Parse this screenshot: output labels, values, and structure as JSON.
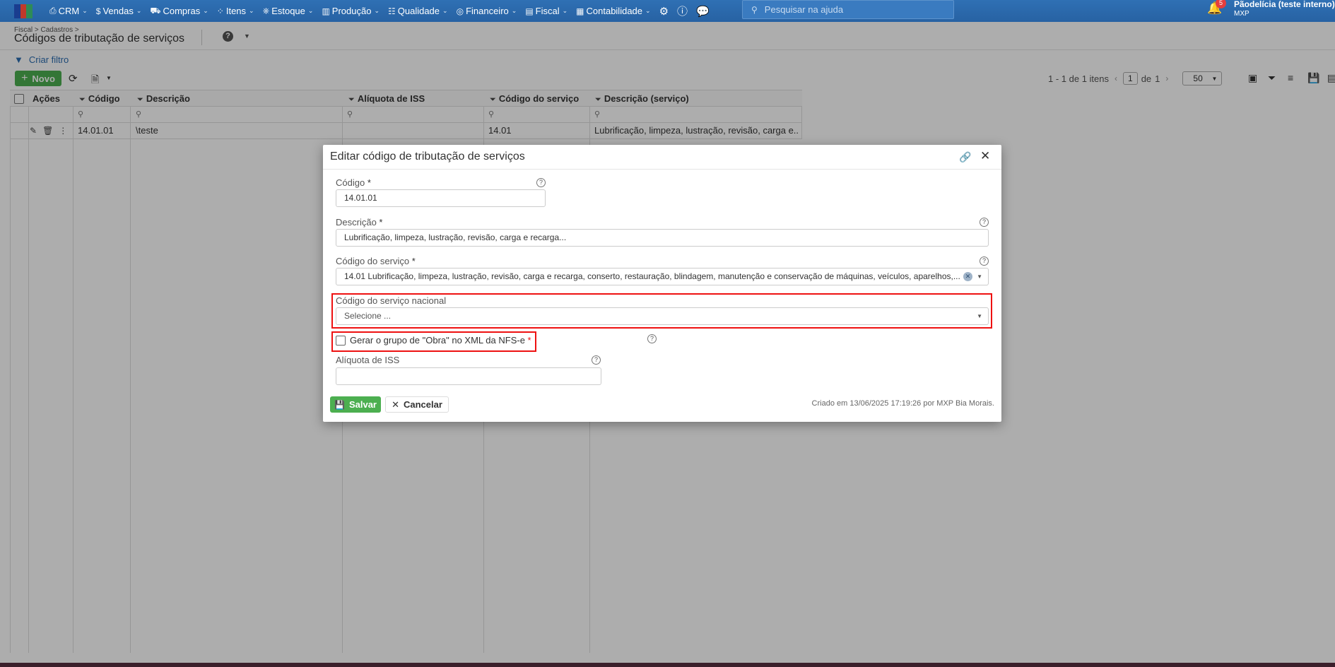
{
  "topbar": {
    "nav": [
      {
        "label": "CRM",
        "icon": "crm-icon",
        "glyph": "⎙"
      },
      {
        "label": "Vendas",
        "icon": "dollar-icon",
        "glyph": "$"
      },
      {
        "label": "Compras",
        "icon": "cart-icon",
        "glyph": "🛒"
      },
      {
        "label": "Itens",
        "icon": "items-icon",
        "glyph": "⁘"
      },
      {
        "label": "Estoque",
        "icon": "stock-icon",
        "glyph": "⎈"
      },
      {
        "label": "Produção",
        "icon": "production-icon",
        "glyph": "▥"
      },
      {
        "label": "Qualidade",
        "icon": "quality-icon",
        "glyph": "☷"
      },
      {
        "label": "Financeiro",
        "icon": "finance-icon",
        "glyph": "◎"
      },
      {
        "label": "Fiscal",
        "icon": "fiscal-icon",
        "glyph": "▤"
      },
      {
        "label": "Contabilidade",
        "icon": "accounting-icon",
        "glyph": "▦"
      }
    ],
    "search_placeholder": "Pesquisar na ajuda",
    "notifications": "5",
    "company_name": "Pãodelícia (teste interno)",
    "company_sub": "MXP"
  },
  "page": {
    "breadcrumb": "Fiscal > Cadastros >",
    "title": "Códigos de tributação de serviços",
    "filter_link": "Criar filtro",
    "new_button": "Novo"
  },
  "pager": {
    "range": "1 - 1 de 1 itens",
    "page": "1",
    "of_label": "de",
    "total_pages": "1",
    "page_size": "50"
  },
  "grid": {
    "columns": [
      "Ações",
      "Código",
      "Descrição",
      "Alíquota de ISS",
      "Código do serviço",
      "Descrição (serviço)"
    ],
    "rows": [
      {
        "codigo": "14.01.01",
        "descricao": "\\teste",
        "aliquota": "",
        "codigo_servico": "14.01",
        "descricao_servico": "Lubrificação, limpeza, lustração, revisão, carga e..."
      }
    ]
  },
  "modal": {
    "title": "Editar código de tributação de serviços",
    "codigo_label": "Código",
    "codigo_value": "14.01.01",
    "descricao_label": "Descrição",
    "descricao_value": "Lubrificação, limpeza, lustração, revisão, carga e recarga...",
    "codigo_servico_label": "Código do serviço",
    "codigo_servico_value": "14.01  Lubrificação, limpeza, lustração, revisão, carga e recarga, conserto, restauração, blindagem, manutenção e conservação de máquinas, veículos, aparelhos,...",
    "codigo_nacional_label": "Código do serviço nacional",
    "codigo_nacional_placeholder": "Selecione ...",
    "obra_label": "Gerar o grupo de \"Obra\" no XML da NFS-e",
    "aliquota_label": "Alíquota de ISS",
    "aliquota_value": "",
    "required_mark": "*",
    "save_button": "Salvar",
    "cancel_button": "Cancelar",
    "created_info": "Criado em 13/06/2025 17:19:26 por MXP Bia Morais."
  },
  "colors": {
    "navbar": "#2b6cb0",
    "primary_green": "#4caf50",
    "highlight_red": "#ee1111",
    "link_blue": "#2b6cb0"
  }
}
